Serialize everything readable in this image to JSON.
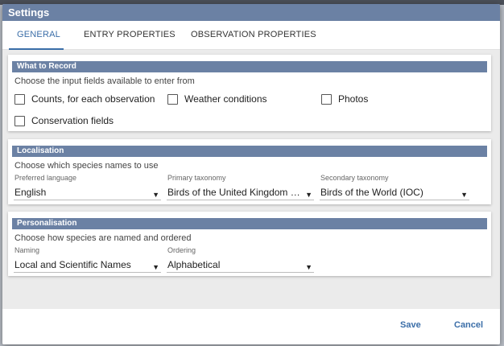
{
  "dialog": {
    "title": "Settings"
  },
  "tabs": [
    {
      "label": "GENERAL"
    },
    {
      "label": "ENTRY PROPERTIES"
    },
    {
      "label": "OBSERVATION PROPERTIES"
    }
  ],
  "what_to_record": {
    "header": "What to Record",
    "description": "Choose the input fields available to enter from",
    "options": [
      {
        "label": "Counts, for each observation",
        "checked": false
      },
      {
        "label": "Weather conditions",
        "checked": false
      },
      {
        "label": "Photos",
        "checked": false
      },
      {
        "label": "Conservation fields",
        "checked": false
      }
    ]
  },
  "localisation": {
    "header": "Localisation",
    "description": "Choose which species names to use",
    "fields": [
      {
        "label": "Preferred language",
        "value": "English"
      },
      {
        "label": "Primary taxonomy",
        "value": "Birds of the United Kingdom (BOU)"
      },
      {
        "label": "Secondary taxonomy",
        "value": "Birds of the World (IOC)"
      }
    ]
  },
  "personalisation": {
    "header": "Personalisation",
    "description": "Choose how species are named and ordered",
    "fields": [
      {
        "label": "Naming",
        "value": "Local and Scientific Names"
      },
      {
        "label": "Ordering",
        "value": "Alphabetical"
      }
    ]
  },
  "footer": {
    "save_label": "Save",
    "cancel_label": "Cancel"
  },
  "colors": {
    "header_bg": "#6b81a4",
    "accent": "#3b6ea8"
  }
}
